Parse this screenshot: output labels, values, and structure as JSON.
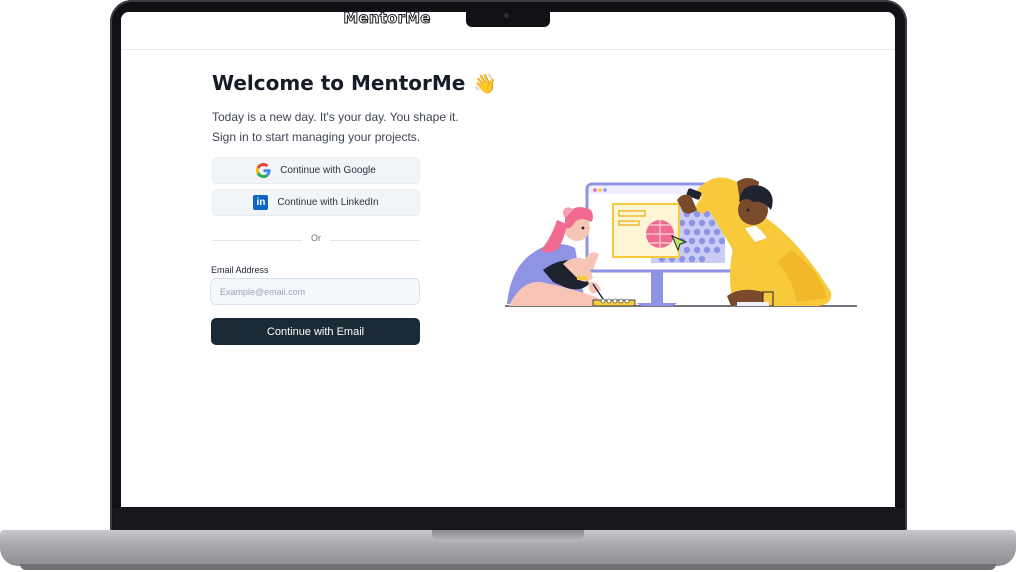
{
  "app": {
    "brand": "MentorMe"
  },
  "hero": {
    "title": "Welcome to MentorMe",
    "emoji": "👋",
    "subtitle_line1": "Today is a new day. It's your day. You shape it.",
    "subtitle_line2": "Sign in to start managing your projects."
  },
  "auth": {
    "google_label": "Continue with Google",
    "linkedin_label": "Continue with LinkedIn",
    "linkedin_icon_text": "in",
    "divider_text": "Or",
    "email_label": "Email Address",
    "email_placeholder": "Example@email.com",
    "email_value": "",
    "submit_label": "Continue with Email"
  },
  "icons": {
    "google": "google-logo-icon",
    "linkedin": "linkedin-logo-icon"
  },
  "colors": {
    "primary_button": "#1b2b36",
    "sso_button_bg": "#f1f5f8",
    "linkedin_blue": "#0a66c2",
    "illustration_yellow": "#f8c93a",
    "illustration_purple": "#8e93e3",
    "illustration_pink": "#f06b8f"
  }
}
